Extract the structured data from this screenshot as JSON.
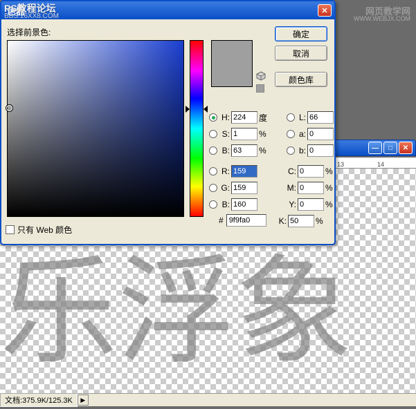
{
  "watermarks": {
    "tl_line1": "PS教程论坛",
    "tl_line2": "BBS.16XX8.COM",
    "tr_line1": "网页教学网",
    "tr_line2": "WWW.WEBJX.COM"
  },
  "dialog": {
    "title": "色器",
    "prompt": "选择前景色:",
    "buttons": {
      "ok": "确定",
      "cancel": "取消",
      "lib": "颜色库"
    },
    "fields": {
      "H": {
        "label": "H:",
        "value": "224",
        "unit": "度",
        "selected": true
      },
      "S": {
        "label": "S:",
        "value": "1",
        "unit": "%",
        "selected": false
      },
      "Bv": {
        "label": "B:",
        "value": "63",
        "unit": "%",
        "selected": false
      },
      "R": {
        "label": "R:",
        "value": "159",
        "highlighted": true
      },
      "G": {
        "label": "G:",
        "value": "159"
      },
      "Bb": {
        "label": "B:",
        "value": "160"
      },
      "L": {
        "label": "L:",
        "value": "66"
      },
      "a": {
        "label": "a:",
        "value": "0"
      },
      "b": {
        "label": "b:",
        "value": "0"
      },
      "C": {
        "label": "C:",
        "value": "0",
        "unit": "%"
      },
      "M": {
        "label": "M:",
        "value": "0",
        "unit": "%"
      },
      "Y": {
        "label": "Y:",
        "value": "0",
        "unit": "%"
      },
      "K": {
        "label": "K:",
        "value": "50",
        "unit": "%"
      }
    },
    "hex": {
      "hash": "#",
      "value": "9f9fa0"
    },
    "web_only_label": "只有 Web 颜色",
    "swatch_color": "#9f9fa0"
  },
  "ruler": {
    "tick1": "13",
    "tick2": "14"
  },
  "canvas_text": "乐浮象",
  "status": {
    "doc_label": "文档:",
    "doc_value": "375.9K/125.3K",
    "arrow": "▶"
  }
}
